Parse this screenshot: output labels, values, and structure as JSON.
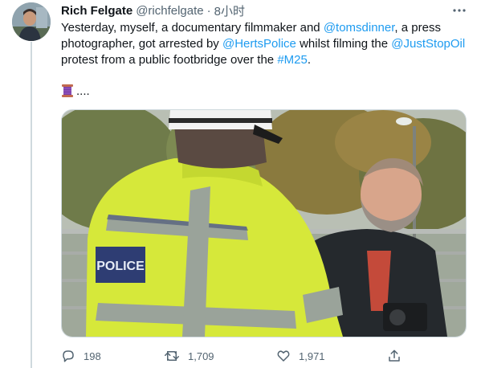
{
  "tweet": {
    "author": {
      "display_name": "Rich Felgate",
      "handle": "@richfelgate",
      "separator": "·",
      "time": "8小时"
    },
    "more_icon": "more-horizontal-icon",
    "text_parts": {
      "p1": "Yesterday, myself, a documentary filmmaker and ",
      "mention_toms": "@tomsdinner",
      "p2": ", a press photographer, got arrested by ",
      "mention_herts": "@HertsPolice",
      "p3": " whilst filming the ",
      "mention_jso": "@JustStopOil",
      "p4": " protest from a public footbridge over the ",
      "hashtag": "#M25",
      "p5": "."
    },
    "emoji_line": {
      "emoji": "thread-spool-emoji",
      "trailing": "...."
    },
    "media": {
      "police_badge": "POLICE"
    },
    "actions": {
      "reply": {
        "icon": "reply-icon",
        "count": "198"
      },
      "retweet": {
        "icon": "retweet-icon",
        "count": "1,709"
      },
      "like": {
        "icon": "heart-icon",
        "count": "1,971"
      },
      "share": {
        "icon": "share-icon"
      }
    },
    "colors": {
      "link": "#1d9bf0",
      "secondary_text": "#536471",
      "primary_text": "#0f1419",
      "hi_vis": "#d6e83a"
    }
  }
}
